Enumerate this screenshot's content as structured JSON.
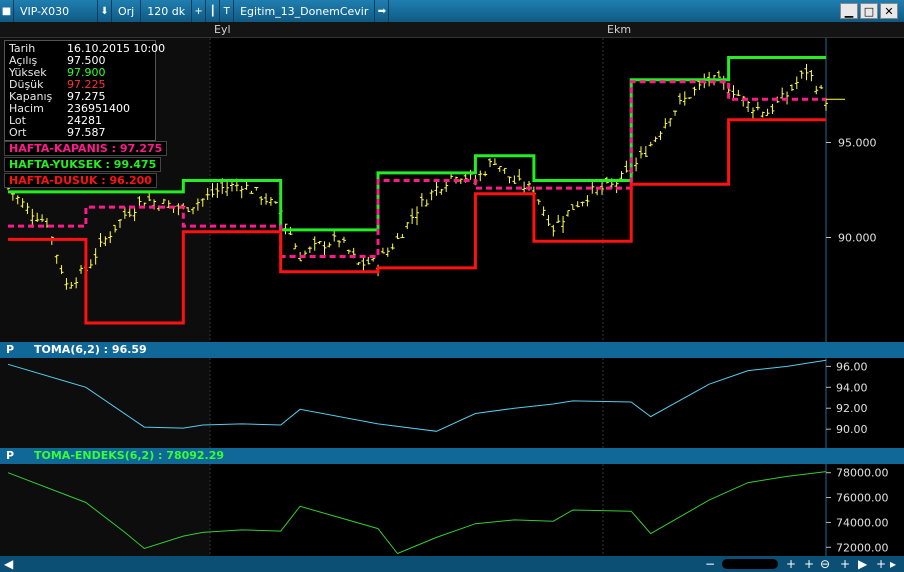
{
  "toolbar": {
    "symbol": "VIP-X030",
    "mode": "Orj",
    "period": "120 dk",
    "template": "Egitim_13_DonemCevir"
  },
  "date_axis": {
    "labels": [
      "Eyl",
      "Ekm"
    ]
  },
  "info": {
    "rows": [
      {
        "key": "Tarih",
        "value": "16.10.2015 10:00",
        "color": "#ffffff"
      },
      {
        "key": "Açılış",
        "value": "97.500",
        "color": "#ffffff"
      },
      {
        "key": "Yüksek",
        "value": "97.900",
        "color": "#33ff33"
      },
      {
        "key": "Düşük",
        "value": "97.225",
        "color": "#ff3333"
      },
      {
        "key": "Kapanış",
        "value": "97.275",
        "color": "#ffffff"
      },
      {
        "key": "Hacim",
        "value": "236951400",
        "color": "#ffffff"
      },
      {
        "key": "Lot",
        "value": "24281",
        "color": "#ffffff"
      },
      {
        "key": "Ort",
        "value": "97.587",
        "color": "#ffffff"
      }
    ]
  },
  "legend": {
    "kapanis": "HAFTA-KAPANIS : 97.275",
    "yuksek": "HAFTA-YUKSEK : 99.475",
    "dusuk": "HAFTA-DUSUK : 96.200"
  },
  "panels": {
    "p_label": "P",
    "toma": "TOMA(6,2) : 96.59",
    "toma_endeks": "TOMA-ENDEKS(6,2) : 78092.29"
  },
  "colors": {
    "price": "#ffff44",
    "week_high": "#22ee22",
    "week_low": "#ff1111",
    "week_close": "#ff1a8c",
    "toma": "#55ccee",
    "toma_endeks": "#33cc33",
    "panel_bar": "#106898"
  },
  "chart_data": [
    {
      "type": "line",
      "x_labels": [
        "Eyl",
        "Ekm"
      ],
      "y_ticks": [
        "95.000",
        "90.000"
      ],
      "ylim": [
        84.5,
        100.5
      ],
      "current_value": 97.275,
      "series": [
        {
          "name": "HAFTA-YUKSEK",
          "style": "step",
          "points": [
            [
              0,
              92.4
            ],
            [
              9,
              92.4
            ],
            [
              9,
              93.0
            ],
            [
              14,
              93.0
            ],
            [
              14,
              90.4
            ],
            [
              19,
              90.4
            ],
            [
              19,
              93.4
            ],
            [
              24,
              93.4
            ],
            [
              24,
              94.3
            ],
            [
              27,
              94.3
            ],
            [
              27,
              93.0
            ],
            [
              32,
              93.0
            ],
            [
              32,
              98.3
            ],
            [
              37,
              98.3
            ],
            [
              37,
              99.475
            ],
            [
              42,
              99.475
            ]
          ]
        },
        {
          "name": "HAFTA-KAPANIS",
          "style": "dashed-step",
          "points": [
            [
              0,
              90.6
            ],
            [
              4,
              90.6
            ],
            [
              4,
              91.6
            ],
            [
              9,
              91.6
            ],
            [
              9,
              90.6
            ],
            [
              14,
              90.6
            ],
            [
              14,
              89.0
            ],
            [
              19,
              89.0
            ],
            [
              19,
              93.0
            ],
            [
              24,
              93.0
            ],
            [
              24,
              92.6
            ],
            [
              27,
              92.6
            ],
            [
              27,
              92.6
            ],
            [
              32,
              92.6
            ],
            [
              32,
              98.2
            ],
            [
              37,
              98.2
            ],
            [
              37,
              97.275
            ],
            [
              42,
              97.275
            ]
          ]
        },
        {
          "name": "HAFTA-DUSUK",
          "style": "step",
          "points": [
            [
              0,
              89.9
            ],
            [
              4,
              89.9
            ],
            [
              4,
              85.5
            ],
            [
              9,
              85.5
            ],
            [
              9,
              90.3
            ],
            [
              14,
              90.3
            ],
            [
              14,
              88.2
            ],
            [
              19,
              88.2
            ],
            [
              19,
              88.4
            ],
            [
              24,
              88.4
            ],
            [
              24,
              92.3
            ],
            [
              27,
              92.3
            ],
            [
              27,
              89.8
            ],
            [
              32,
              89.8
            ],
            [
              32,
              92.8
            ],
            [
              37,
              92.8
            ],
            [
              37,
              96.2
            ],
            [
              42,
              96.2
            ]
          ]
        },
        {
          "name": "Fiyat",
          "style": "ohlc",
          "closes": [
            92.6,
            91.5,
            90.8,
            87.5,
            88.3,
            89.9,
            91.2,
            92.0,
            91.8,
            91.5,
            92.0,
            92.6,
            92.8,
            92.2,
            91.4,
            89.0,
            89.6,
            89.9,
            88.6,
            88.7,
            89.9,
            91.5,
            92.6,
            93.4,
            93.0,
            94.1,
            92.9,
            92.5,
            90.5,
            91.6,
            92.4,
            92.7,
            93.5,
            94.9,
            96.5,
            97.5,
            98.3,
            98.0,
            97.0,
            96.6,
            97.5,
            98.8,
            97.275
          ],
          "values_note": "approx, 2-hour bars"
        }
      ]
    },
    {
      "type": "line",
      "y_ticks": [
        "96.00",
        "94.00",
        "92.00",
        "90.00"
      ],
      "ylim": [
        88.2,
        96.8
      ],
      "series": [
        {
          "name": "TOMA(6,2)",
          "x": [
            0,
            4,
            7,
            9,
            10,
            12,
            14,
            15,
            19,
            22,
            24,
            26,
            28,
            29,
            32,
            33,
            36,
            38,
            40,
            42
          ],
          "values": [
            96.2,
            94.0,
            90.2,
            90.1,
            90.4,
            90.5,
            90.4,
            91.9,
            90.5,
            89.8,
            91.5,
            92.0,
            92.4,
            92.7,
            92.6,
            91.2,
            94.3,
            95.6,
            96.0,
            96.59
          ]
        }
      ]
    },
    {
      "type": "line",
      "y_ticks": [
        "78000.00",
        "76000.00",
        "74000.00",
        "72000.00"
      ],
      "ylim": [
        71300,
        78700
      ],
      "series": [
        {
          "name": "TOMA-ENDEKS(6,2)",
          "x": [
            0,
            4,
            6,
            7,
            9,
            10,
            12,
            14,
            15,
            19,
            20,
            22,
            24,
            26,
            28,
            29,
            32,
            33,
            36,
            38,
            40,
            42
          ],
          "values": [
            78000,
            75600,
            73200,
            71900,
            72900,
            73200,
            73400,
            73300,
            75300,
            73500,
            71500,
            72800,
            73900,
            74200,
            74100,
            75000,
            74900,
            73100,
            75800,
            77200,
            77700,
            78092.29
          ]
        }
      ]
    }
  ]
}
